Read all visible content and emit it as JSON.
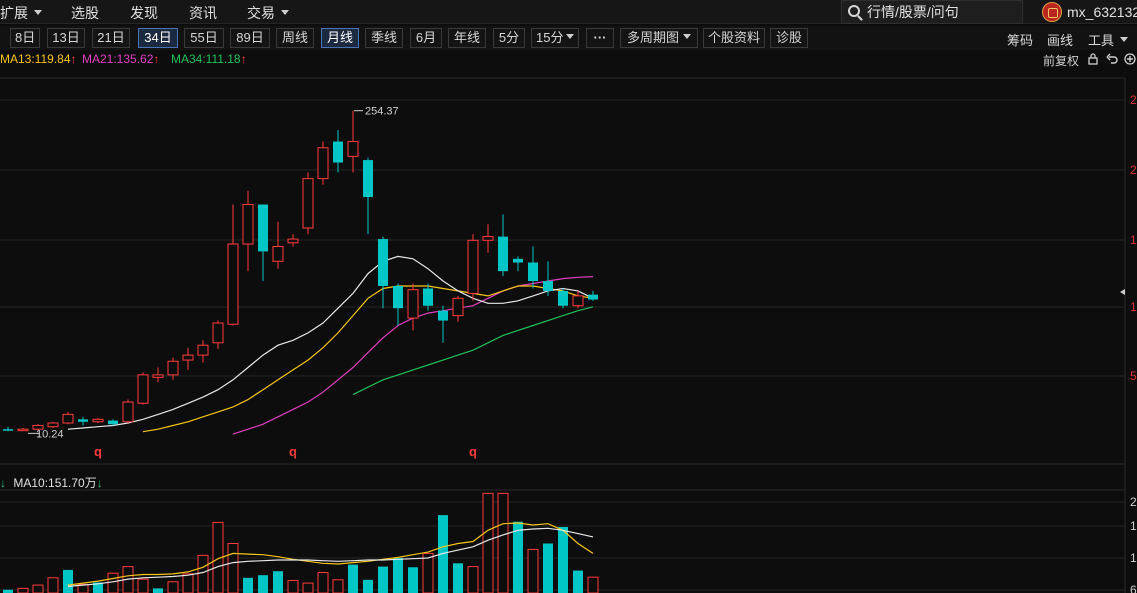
{
  "nav": {
    "items": [
      {
        "label": "扩展",
        "dropdown": true
      },
      {
        "label": "选股",
        "dropdown": false
      },
      {
        "label": "发现",
        "dropdown": false
      },
      {
        "label": "资讯",
        "dropdown": false
      },
      {
        "label": "交易",
        "dropdown": true
      }
    ],
    "search_placeholder": "行情/股票/问句",
    "username": "mx_632132"
  },
  "toolbar": {
    "periods": [
      "8日",
      "13日",
      "21日",
      "34日",
      "55日",
      "89日",
      "周线",
      "月线",
      "季线",
      "6月",
      "年线",
      "5分",
      "15分"
    ],
    "active_periods": [
      "34日",
      "月线"
    ],
    "more_label": "···",
    "multi_period_label": "多周期图",
    "stock_info_label": "个股资料",
    "diagnose_label": "诊股",
    "right_items": [
      "筹码",
      "画线",
      "工具"
    ]
  },
  "ma_legend": {
    "ma13": "MA13:119.84",
    "ma21": "MA21:135.62",
    "ma34": "MA34:111.18",
    "fuquan": "前复权"
  },
  "volume_legend": {
    "ma10": "MA10:151.70万"
  },
  "colors": {
    "up": "#ff3b3b",
    "down": "#00c6c6",
    "ma_white": "#e8e8e8",
    "ma13": "#f5c518",
    "ma21": "#e040c0",
    "ma34": "#21c05a",
    "background": "#0d0d0d"
  },
  "chart_data": [
    {
      "type": "candlestick",
      "title": "",
      "price_labels": {
        "high": "254.37",
        "low": "10.24"
      },
      "y_tick_labels": [
        "2",
        "2",
        "1",
        "1",
        "5"
      ],
      "signal_marks": [
        "q",
        "q",
        "q"
      ],
      "ylim": [
        0,
        290
      ],
      "candles": [
        {
          "o": 12,
          "h": 14,
          "l": 10.24,
          "c": 11
        },
        {
          "o": 11,
          "h": 13,
          "l": 10.5,
          "c": 12
        },
        {
          "o": 12,
          "h": 16,
          "l": 11,
          "c": 15
        },
        {
          "o": 14,
          "h": 18,
          "l": 13,
          "c": 17
        },
        {
          "o": 17,
          "h": 26,
          "l": 16,
          "c": 24
        },
        {
          "o": 20,
          "h": 22,
          "l": 15,
          "c": 18
        },
        {
          "o": 18,
          "h": 21,
          "l": 17,
          "c": 20
        },
        {
          "o": 19,
          "h": 20,
          "l": 15,
          "c": 16
        },
        {
          "o": 18,
          "h": 36,
          "l": 17,
          "c": 34
        },
        {
          "o": 33,
          "h": 58,
          "l": 32,
          "c": 56
        },
        {
          "o": 54,
          "h": 62,
          "l": 50,
          "c": 56
        },
        {
          "o": 56,
          "h": 70,
          "l": 52,
          "c": 67
        },
        {
          "o": 68,
          "h": 78,
          "l": 60,
          "c": 72
        },
        {
          "o": 72,
          "h": 84,
          "l": 66,
          "c": 80
        },
        {
          "o": 82,
          "h": 100,
          "l": 77,
          "c": 98
        },
        {
          "o": 97,
          "h": 194,
          "l": 96,
          "c": 162
        },
        {
          "o": 162,
          "h": 205,
          "l": 140,
          "c": 194
        },
        {
          "o": 194,
          "h": 192,
          "l": 132,
          "c": 156
        },
        {
          "o": 148,
          "h": 180,
          "l": 142,
          "c": 160
        },
        {
          "o": 163,
          "h": 170,
          "l": 160,
          "c": 166
        },
        {
          "o": 175,
          "h": 220,
          "l": 170,
          "c": 215
        },
        {
          "o": 215,
          "h": 245,
          "l": 210,
          "c": 240
        },
        {
          "o": 245,
          "h": 254.37,
          "l": 220,
          "c": 228
        },
        {
          "o": 233,
          "h": 270,
          "l": 220,
          "c": 245
        },
        {
          "o": 230,
          "h": 232,
          "l": 170,
          "c": 200
        },
        {
          "o": 166,
          "h": 168,
          "l": 110,
          "c": 128
        },
        {
          "o": 128,
          "h": 130,
          "l": 96,
          "c": 110
        },
        {
          "o": 102,
          "h": 130,
          "l": 92,
          "c": 125
        },
        {
          "o": 126,
          "h": 130,
          "l": 108,
          "c": 112
        },
        {
          "o": 108,
          "h": 112,
          "l": 82,
          "c": 100
        },
        {
          "o": 104,
          "h": 120,
          "l": 99,
          "c": 118
        },
        {
          "o": 122,
          "h": 170,
          "l": 116,
          "c": 165
        },
        {
          "o": 165,
          "h": 178,
          "l": 155,
          "c": 168
        },
        {
          "o": 168,
          "h": 186,
          "l": 136,
          "c": 140
        },
        {
          "o": 150,
          "h": 152,
          "l": 140,
          "c": 147
        },
        {
          "o": 147,
          "h": 160,
          "l": 126,
          "c": 132
        },
        {
          "o": 132,
          "h": 148,
          "l": 120,
          "c": 124
        },
        {
          "o": 124,
          "h": 126,
          "l": 110,
          "c": 112
        },
        {
          "o": 112,
          "h": 124,
          "l": 110,
          "c": 120
        },
        {
          "o": 121,
          "h": 124,
          "l": 116,
          "c": 117
        }
      ],
      "ma_white": [
        null,
        null,
        null,
        null,
        12,
        13,
        14,
        15,
        17,
        20,
        24,
        28,
        33,
        38,
        44,
        52,
        62,
        72,
        80,
        84,
        90,
        98,
        110,
        122,
        138,
        148,
        152,
        150,
        142,
        132,
        124,
        118,
        114,
        114,
        116,
        120,
        124,
        126,
        124,
        118
      ],
      "ma13": [
        null,
        null,
        null,
        null,
        null,
        null,
        null,
        null,
        null,
        10,
        12,
        15,
        18,
        22,
        26,
        30,
        36,
        44,
        52,
        60,
        68,
        78,
        90,
        104,
        118,
        126,
        128,
        128,
        128,
        126,
        124,
        122,
        120,
        124,
        128,
        128,
        126,
        124,
        120,
        118
      ],
      "ma21": [
        null,
        null,
        null,
        null,
        null,
        null,
        null,
        null,
        null,
        null,
        null,
        null,
        null,
        null,
        null,
        8,
        12,
        16,
        22,
        28,
        34,
        42,
        52,
        62,
        74,
        86,
        96,
        102,
        106,
        108,
        110,
        112,
        118,
        124,
        128,
        130,
        132,
        134,
        135,
        135.62
      ],
      "ma34": [
        null,
        null,
        null,
        null,
        null,
        null,
        null,
        null,
        null,
        null,
        null,
        null,
        null,
        null,
        null,
        null,
        null,
        null,
        null,
        null,
        null,
        null,
        null,
        40,
        46,
        52,
        56,
        60,
        64,
        68,
        72,
        76,
        82,
        88,
        92,
        96,
        100,
        104,
        108,
        111.18
      ]
    },
    {
      "type": "bar",
      "title": "",
      "series_name": "volume",
      "y_tick_labels": [
        "2",
        "1",
        "1",
        "6"
      ],
      "ylim": [
        0,
        300
      ],
      "volume": [
        {
          "v": 10,
          "up": false
        },
        {
          "v": 14,
          "up": true
        },
        {
          "v": 24,
          "up": true
        },
        {
          "v": 46,
          "up": true
        },
        {
          "v": 70,
          "up": false
        },
        {
          "v": 26,
          "up": true
        },
        {
          "v": 32,
          "up": false
        },
        {
          "v": 60,
          "up": true
        },
        {
          "v": 80,
          "up": true
        },
        {
          "v": 42,
          "up": true
        },
        {
          "v": 14,
          "up": false
        },
        {
          "v": 34,
          "up": true
        },
        {
          "v": 58,
          "up": true
        },
        {
          "v": 114,
          "up": true
        },
        {
          "v": 214,
          "up": true
        },
        {
          "v": 150,
          "up": true
        },
        {
          "v": 46,
          "up": false
        },
        {
          "v": 54,
          "up": false
        },
        {
          "v": 66,
          "up": false
        },
        {
          "v": 38,
          "up": true
        },
        {
          "v": 30,
          "up": true
        },
        {
          "v": 62,
          "up": true
        },
        {
          "v": 40,
          "up": true
        },
        {
          "v": 86,
          "up": false
        },
        {
          "v": 40,
          "up": false
        },
        {
          "v": 80,
          "up": false
        },
        {
          "v": 106,
          "up": false
        },
        {
          "v": 78,
          "up": false
        },
        {
          "v": 120,
          "up": true
        },
        {
          "v": 236,
          "up": false
        },
        {
          "v": 90,
          "up": false
        },
        {
          "v": 80,
          "up": true
        },
        {
          "v": 302,
          "up": true
        },
        {
          "v": 302,
          "up": true
        },
        {
          "v": 216,
          "up": false
        },
        {
          "v": 132,
          "up": true
        },
        {
          "v": 150,
          "up": false
        },
        {
          "v": 200,
          "up": false
        },
        {
          "v": 68,
          "up": false
        },
        {
          "v": 48,
          "up": true
        }
      ],
      "vol_ma_white": [
        null,
        null,
        null,
        null,
        20,
        24,
        28,
        34,
        42,
        46,
        48,
        50,
        54,
        62,
        80,
        92,
        96,
        98,
        100,
        100,
        100,
        98,
        96,
        98,
        100,
        100,
        102,
        104,
        106,
        120,
        130,
        140,
        160,
        176,
        190,
        194,
        196,
        190,
        180,
        170
      ],
      "vol_ma_yellow": [
        null,
        null,
        null,
        null,
        24,
        30,
        36,
        44,
        52,
        56,
        56,
        58,
        64,
        78,
        104,
        120,
        118,
        116,
        110,
        102,
        96,
        90,
        88,
        92,
        96,
        102,
        108,
        116,
        124,
        140,
        150,
        156,
        190,
        210,
        212,
        206,
        210,
        190,
        150,
        120
      ]
    }
  ]
}
